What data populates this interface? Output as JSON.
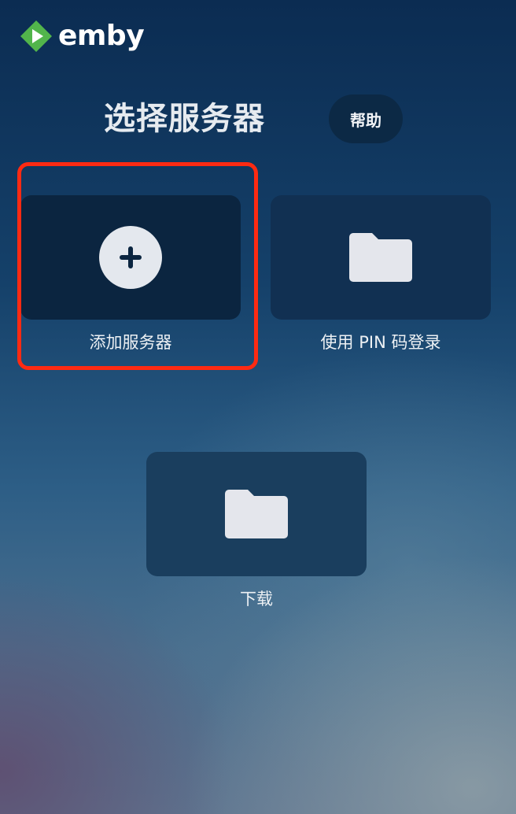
{
  "app": {
    "logo_text": "emby",
    "brand_color": "#52b54b"
  },
  "header": {
    "title": "选择服务器",
    "help_label": "帮助"
  },
  "cards": {
    "add_server": {
      "label": "添加服务器",
      "icon": "plus-circle-icon"
    },
    "pin_login": {
      "label": "使用 PIN 码登录",
      "icon": "folder-icon"
    },
    "downloads": {
      "label": "下载",
      "icon": "folder-icon"
    }
  },
  "annotation": {
    "highlight_color": "#ff2a12"
  }
}
